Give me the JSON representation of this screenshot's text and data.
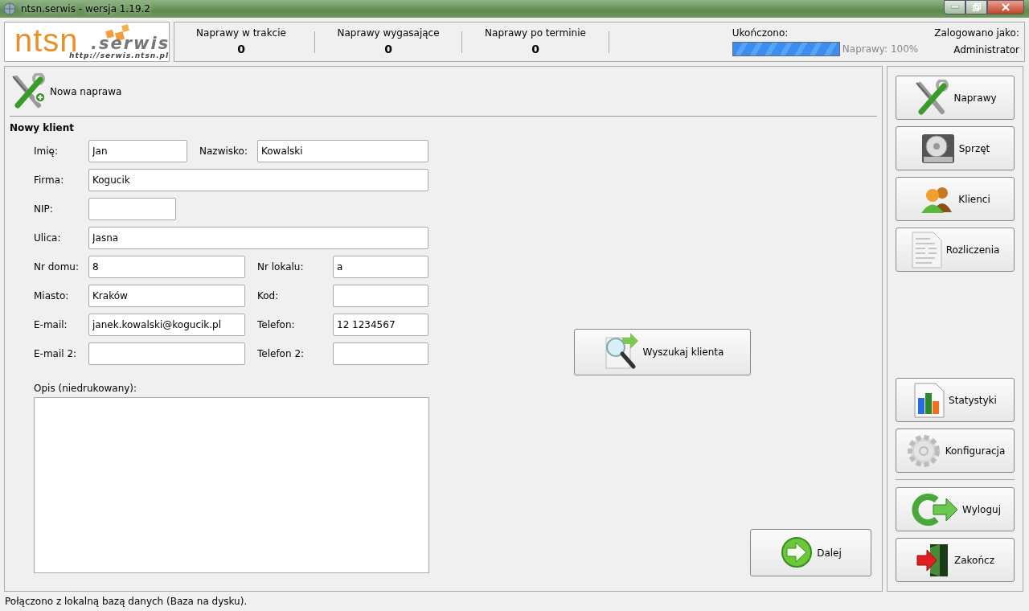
{
  "window": {
    "title": "ntsn.serwis - wersja 1.19.2"
  },
  "logo": {
    "name": "ntsn",
    "suffix": ".serwis",
    "url": "http://serwis.ntsn.pl"
  },
  "stats": [
    {
      "label": "Naprawy w trakcie",
      "value": "0"
    },
    {
      "label": "Naprawy wygasające",
      "value": "0"
    },
    {
      "label": "Naprawy po terminie",
      "value": "0"
    }
  ],
  "progress": {
    "label": "Ukończono:",
    "level": 1.0,
    "reading": "Naprawy: 100%"
  },
  "login": {
    "label": "Zalogowano jako:",
    "user": "Administrator"
  },
  "toolbar": {
    "label": "Nowa naprawa"
  },
  "section_title": "Nowy klient",
  "form_rows": [
    {
      "kind": "name-pair",
      "fields": [
        {
          "label": "Imię:",
          "value": "Jan"
        },
        {
          "label": "Nazwisko:",
          "value": "Kowalski"
        }
      ]
    },
    {
      "kind": "wide",
      "fields": [
        {
          "label": "Firma:",
          "value": "Kogucik"
        }
      ]
    },
    {
      "kind": "short",
      "fields": [
        {
          "label": "NIP:"
        }
      ]
    },
    {
      "kind": "wide",
      "fields": [
        {
          "label": "Ulica:",
          "value": "Jasna"
        }
      ]
    },
    {
      "kind": "pair",
      "fields": [
        {
          "label": "Nr domu:",
          "value": "8"
        },
        {
          "label": "Nr lokalu:",
          "value": "a"
        }
      ]
    },
    {
      "kind": "pair",
      "fields": [
        {
          "label": "Miasto:",
          "value": "Kraków"
        },
        {
          "label": "Kod:"
        }
      ]
    },
    {
      "kind": "pair",
      "fields": [
        {
          "label": "E-mail:",
          "value": "janek.kowalski@kogucik.pl"
        },
        {
          "label": "Telefon:",
          "value": "12 1234567"
        }
      ]
    },
    {
      "kind": "pair",
      "fields": [
        {
          "label": "E-mail 2:"
        },
        {
          "label": "Telefon 2:"
        }
      ]
    }
  ],
  "notes": {
    "label": "Opis (niedrukowany):"
  },
  "search_button": {
    "label": "Wyszukaj klienta"
  },
  "next_button": {
    "label": "Dalej"
  },
  "sidebar": {
    "top": [
      {
        "label": "Naprawy"
      },
      {
        "label": "Sprzęt"
      },
      {
        "label": "Klienci"
      },
      {
        "label": "Rozliczenia"
      }
    ],
    "middle": [
      {
        "label": "Statystyki"
      },
      {
        "label": "Konfiguracja"
      }
    ],
    "bottom": [
      {
        "label": "Wyloguj"
      },
      {
        "label": "Zakończ"
      }
    ]
  },
  "status_bar": "Połączono z lokalną bazą danych (Baza na dysku)."
}
